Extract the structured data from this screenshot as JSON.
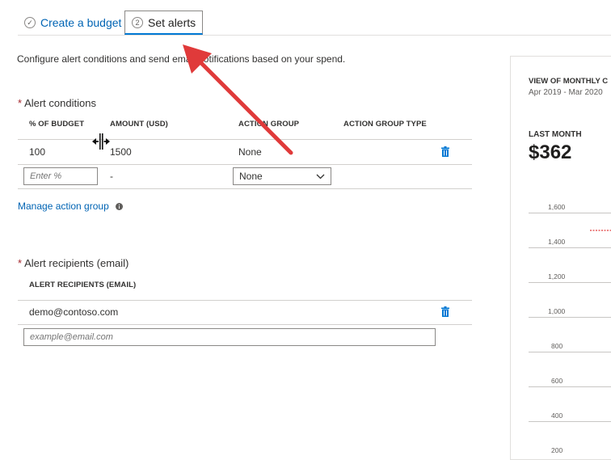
{
  "tabs": [
    {
      "label": "Create a budget",
      "badge": "✓"
    },
    {
      "label": "Set alerts",
      "badge": "2"
    }
  ],
  "description": "Configure alert conditions and send email notifications based on your spend.",
  "alert_conditions": {
    "title": "Alert conditions",
    "columns": [
      "% OF BUDGET",
      "AMOUNT (USD)",
      "ACTION GROUP",
      "ACTION GROUP TYPE"
    ],
    "rows": [
      {
        "percent": "100",
        "amount": "1500",
        "action_group": "None"
      }
    ],
    "new_row": {
      "percent_placeholder": "Enter %",
      "amount": "-",
      "action_group_selected": "None"
    }
  },
  "manage_link": "Manage action group",
  "alert_recipients": {
    "title": "Alert recipients (email)",
    "column": "ALERT RECIPIENTS (EMAIL)",
    "rows": [
      "demo@contoso.com"
    ],
    "placeholder": "example@email.com"
  },
  "panel": {
    "title": "VIEW OF MONTHLY C",
    "subtitle": "Apr 2019 - Mar 2020",
    "last_month_label": "LAST MONTH",
    "last_month_value": "$362",
    "y_ticks": [
      "1,600",
      "1,400",
      "1,200",
      "1,000",
      "800",
      "600",
      "400",
      "200"
    ]
  },
  "colors": {
    "accent": "#0078d4",
    "link": "#0064b4",
    "arrow": "#e03a3a",
    "required": "#a4262c"
  }
}
